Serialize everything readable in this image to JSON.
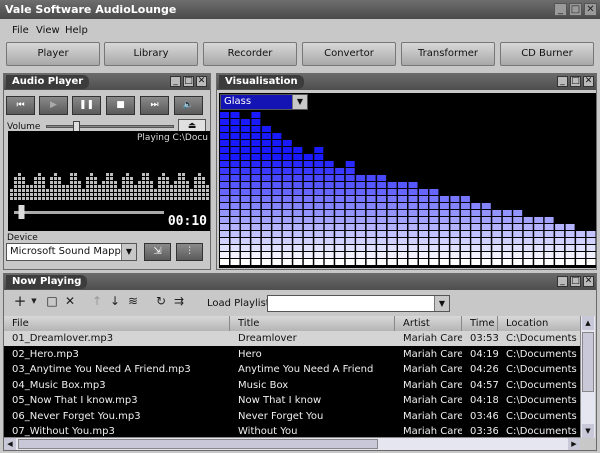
{
  "app": {
    "title": "Vale Software AudioLounge"
  },
  "menu": {
    "file": "File",
    "view": "View",
    "help": "Help"
  },
  "nav": [
    "Player",
    "Library",
    "Recorder",
    "Convertor",
    "Transformer",
    "CD Burner"
  ],
  "player": {
    "title": "Audio Player",
    "volume_label": "Volume",
    "playing_text": "Playing C:\\Docu",
    "time": "00:10",
    "device_label": "Device",
    "device_value": "Microsoft Sound Mapper",
    "icons": [
      "skip-back-icon",
      "play-icon",
      "pause-icon",
      "stop-icon",
      "skip-forward-icon",
      "speaker-icon"
    ],
    "volume_level": 0.2,
    "position_level": 0.03
  },
  "visualisation": {
    "title": "Visualisation",
    "preset": "Glass",
    "colors": {
      "bar_top": "#1a1aff",
      "bar_bottom": "#ffffff",
      "background": "#000000"
    },
    "levels": [
      0.92,
      0.92,
      0.86,
      0.9,
      0.82,
      0.78,
      0.74,
      0.7,
      0.68,
      0.72,
      0.64,
      0.6,
      0.62,
      0.56,
      0.54,
      0.56,
      0.52,
      0.5,
      0.48,
      0.46,
      0.44,
      0.42,
      0.4,
      0.4,
      0.38,
      0.36,
      0.34,
      0.34,
      0.32,
      0.3,
      0.3,
      0.28,
      0.26,
      0.24,
      0.22,
      0.2
    ]
  },
  "nowplaying": {
    "title": "Now Playing",
    "load_label": "Load Playlist",
    "columns": [
      "File",
      "Title",
      "Artist",
      "Time",
      "Location"
    ],
    "rows": [
      [
        "01_Dreamlover.mp3",
        "Dreamlover",
        "Mariah Carey",
        "03:53",
        "C:\\Documents and"
      ],
      [
        "02_Hero.mp3",
        "Hero",
        "Mariah Carey",
        "04:19",
        "C:\\Documents and"
      ],
      [
        "03_Anytime You Need A Friend.mp3",
        "Anytime You Need A Friend",
        "Mariah Carey",
        "04:26",
        "C:\\Documents and"
      ],
      [
        "04_Music Box.mp3",
        "Music Box",
        "Mariah Carey",
        "04:57",
        "C:\\Documents and"
      ],
      [
        "05_Now That I know.mp3",
        "Now That I know",
        "Mariah Carey",
        "04:18",
        "C:\\Documents and"
      ],
      [
        "06_Never Forget You.mp3",
        "Never Forget You",
        "Mariah Carey",
        "03:46",
        "C:\\Documents and"
      ],
      [
        "07_Without You.mp3",
        "Without You",
        "Mariah Carey",
        "03:36",
        "C:\\Documents and"
      ]
    ]
  }
}
